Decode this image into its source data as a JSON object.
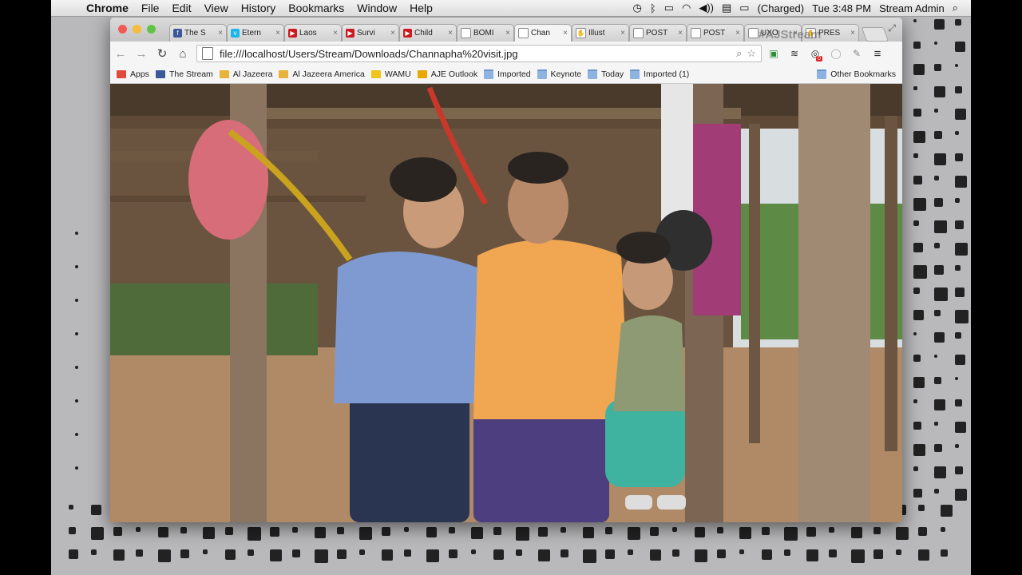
{
  "menubar": {
    "app": "Chrome",
    "items": [
      "File",
      "Edit",
      "View",
      "History",
      "Bookmarks",
      "Window",
      "Help"
    ],
    "battery": "(Charged)",
    "clock": "Tue 3:48 PM",
    "user": "Stream Admin"
  },
  "tabs": [
    {
      "label": "The S",
      "icon": "facebook-icon",
      "color": "#3b5998",
      "glyph": "f"
    },
    {
      "label": "Etern",
      "icon": "vimeo-icon",
      "color": "#1ab7ea",
      "glyph": "v"
    },
    {
      "label": "Laos",
      "icon": "youtube-icon",
      "color": "#cc181e",
      "glyph": "▶"
    },
    {
      "label": "Survi",
      "icon": "youtube-icon",
      "color": "#cc181e",
      "glyph": "▶"
    },
    {
      "label": "Child",
      "icon": "youtube-icon",
      "color": "#cc181e",
      "glyph": "▶"
    },
    {
      "label": "BOMI",
      "icon": "document-icon",
      "color": "#ffffff",
      "glyph": ""
    },
    {
      "label": "Chan",
      "icon": "document-icon",
      "color": "#ffffff",
      "glyph": "",
      "active": true
    },
    {
      "label": "Illust",
      "icon": "hand-icon",
      "color": "#ffffff",
      "glyph": "✋"
    },
    {
      "label": "POST",
      "icon": "document-icon",
      "color": "#ffffff",
      "glyph": ""
    },
    {
      "label": "POST",
      "icon": "document-icon",
      "color": "#ffffff",
      "glyph": ""
    },
    {
      "label": "UXO",
      "icon": "document-icon",
      "color": "#ffffff",
      "glyph": ""
    },
    {
      "label": "PRES",
      "icon": "hand-icon",
      "color": "#ffffff",
      "glyph": "✋"
    }
  ],
  "watermark": "#AJStream",
  "toolbar": {
    "url": "file:///localhost/Users/Stream/Downloads/Channapha%20visit.jpg",
    "extension_badge": "0"
  },
  "bookmarks": [
    {
      "label": "Apps",
      "icon": "apps-icon",
      "color": "#e04b3c"
    },
    {
      "label": "The Stream",
      "icon": "facebook-icon",
      "color": "#3b5998"
    },
    {
      "label": "Al Jazeera",
      "icon": "aljazeera-icon",
      "color": "#e8b33a"
    },
    {
      "label": "Al Jazeera America",
      "icon": "aljazeera-icon",
      "color": "#e8b33a"
    },
    {
      "label": "WAMU",
      "icon": "wamu-icon",
      "color": "#f0c419"
    },
    {
      "label": "AJE Outlook",
      "icon": "outlook-icon",
      "color": "#e8a800"
    },
    {
      "label": "Imported",
      "icon": "folder-icon",
      "color": "#8fb3e0"
    },
    {
      "label": "Keynote",
      "icon": "folder-icon",
      "color": "#8fb3e0"
    },
    {
      "label": "Today",
      "icon": "folder-icon",
      "color": "#8fb3e0"
    },
    {
      "label": "Imported (1)",
      "icon": "folder-icon",
      "color": "#8fb3e0"
    }
  ],
  "other_bookmarks": "Other Bookmarks"
}
